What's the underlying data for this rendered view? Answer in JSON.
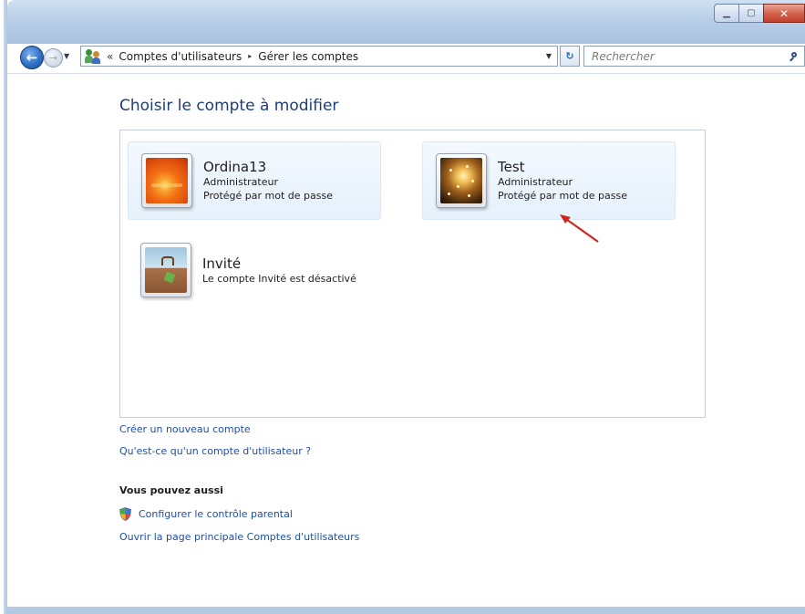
{
  "window": {
    "caption_buttons": {
      "minimize": "▁",
      "maximize": "▢",
      "close": "✕"
    }
  },
  "navigation": {
    "back_icon": "arrow-left",
    "forward_icon": "arrow-right",
    "breadcrumb": {
      "overflow": "«",
      "items": [
        "Comptes d'utilisateurs",
        "Gérer les comptes"
      ],
      "separator": "▸"
    },
    "dropdown_glyph": "▼",
    "refresh_glyph": "↻",
    "search_placeholder": "Rechercher"
  },
  "main": {
    "title": "Choisir le compte à modifier",
    "accounts": [
      {
        "name": "Ordina13",
        "type": "Administrateur",
        "status": "Protégé par mot de passe",
        "avatar": "orange-flower"
      },
      {
        "name": "Test",
        "type": "Administrateur",
        "status": "Protégé par mot de passe",
        "avatar": "golden-sparkles"
      },
      {
        "name": "Invité",
        "status": "Le compte Invité est désactivé",
        "avatar": "suitcase"
      }
    ],
    "links": {
      "create": "Créer un nouveau compte",
      "what_is": "Qu'est-ce qu'un compte d'utilisateur ?"
    },
    "also_section": {
      "heading": "Vous pouvez aussi",
      "parental": "Configurer le contrôle parental",
      "main_page": "Ouvrir la page principale Comptes d'utilisateurs"
    }
  },
  "colors": {
    "link": "#1f4fa3",
    "title": "#1e3d78",
    "annotation_arrow": "#d0251e"
  }
}
